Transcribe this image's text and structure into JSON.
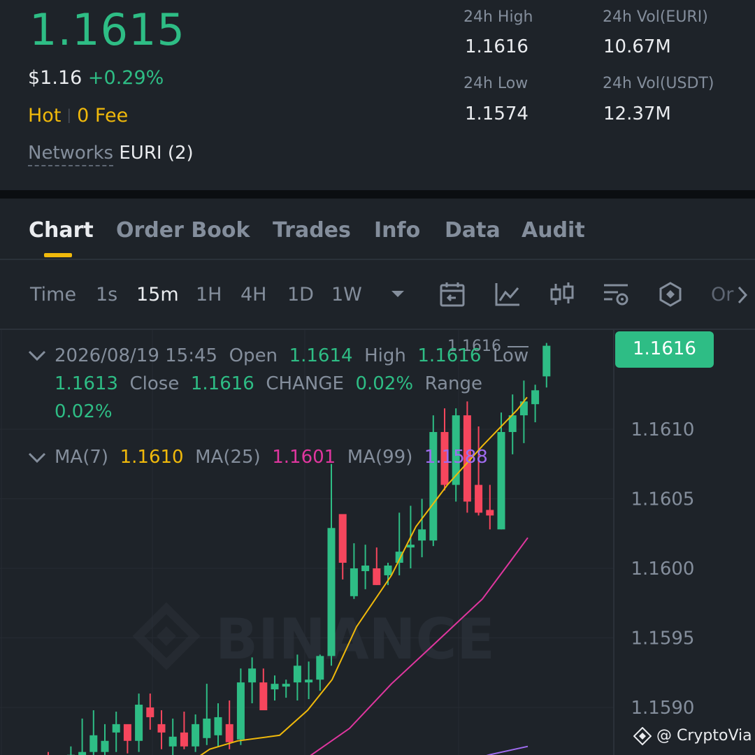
{
  "header": {
    "price": "1.1615",
    "fiat_price": "$1.16",
    "change_pct": "+0.29%",
    "hot_label": "Hot",
    "fee_label": "0 Fee",
    "networks_label": "Networks",
    "networks_value": "EURI (2)"
  },
  "stats": {
    "high_label": "24h High",
    "high_value": "1.1616",
    "low_label": "24h Low",
    "low_value": "1.1574",
    "vol_base_label": "24h Vol(EURI)",
    "vol_base_value": "10.67M",
    "vol_quote_label": "24h Vol(USDT)",
    "vol_quote_value": "12.37M"
  },
  "tabs": [
    "Chart",
    "Order Book",
    "Trades",
    "Info",
    "Data",
    "Audit"
  ],
  "timeframes": [
    "Time",
    "1s",
    "15m",
    "1H",
    "4H",
    "1D",
    "1W"
  ],
  "toolbar_more": "Or",
  "ohlc": {
    "datetime": "2026/08/19 15:45",
    "open_label": "Open",
    "open": "1.1614",
    "high_label": "High",
    "high": "1.1616",
    "low_label": "Low",
    "low": "1.1613",
    "close_label": "Close",
    "close": "1.1616",
    "change_label": "CHANGE",
    "change": "0.02%",
    "range_label": "Range",
    "range": "0.02%"
  },
  "ma": {
    "ma7_label": "MA(7)",
    "ma7": "1.1610",
    "ma25_label": "MA(25)",
    "ma25": "1.1601",
    "ma99_label": "MA(99)",
    "ma99": "1.1588"
  },
  "price_tag": "1.1616",
  "high_marker": "1.1616",
  "watermark_brand": "BINANCE",
  "credit": "@ CryptoVia",
  "colors": {
    "up": "#2ebd85",
    "down": "#f6465d",
    "ma7": "#f0b90b",
    "ma25": "#e0369f",
    "ma99": "#9f6cf0",
    "bg": "#1e2329"
  },
  "chart_data": {
    "type": "candlestick",
    "y_ticks": [
      1.161,
      1.1605,
      1.16,
      1.1595,
      1.159
    ],
    "ylim": [
      1.15857,
      1.16174
    ],
    "candles": [
      {
        "o": 1.15864,
        "h": 1.15868,
        "l": 1.15857,
        "c": 1.1586
      },
      {
        "o": 1.15861,
        "h": 1.15862,
        "l": 1.15857,
        "c": 1.15858
      },
      {
        "o": 1.1586,
        "h": 1.15872,
        "l": 1.15857,
        "c": 1.15866
      },
      {
        "o": 1.15858,
        "h": 1.15892,
        "l": 1.15857,
        "c": 1.15868
      },
      {
        "o": 1.15868,
        "h": 1.15898,
        "l": 1.15862,
        "c": 1.1588
      },
      {
        "o": 1.15868,
        "h": 1.15888,
        "l": 1.15858,
        "c": 1.15876
      },
      {
        "o": 1.15882,
        "h": 1.15897,
        "l": 1.15868,
        "c": 1.15888
      },
      {
        "o": 1.15888,
        "h": 1.15885,
        "l": 1.15867,
        "c": 1.15876
      },
      {
        "o": 1.15876,
        "h": 1.1591,
        "l": 1.15868,
        "c": 1.15902
      },
      {
        "o": 1.159,
        "h": 1.1591,
        "l": 1.15884,
        "c": 1.15893
      },
      {
        "o": 1.15888,
        "h": 1.15898,
        "l": 1.1587,
        "c": 1.15882
      },
      {
        "o": 1.15872,
        "h": 1.15892,
        "l": 1.15865,
        "c": 1.15879
      },
      {
        "o": 1.15882,
        "h": 1.15897,
        "l": 1.1587,
        "c": 1.15872
      },
      {
        "o": 1.15872,
        "h": 1.15895,
        "l": 1.15868,
        "c": 1.15888
      },
      {
        "o": 1.15878,
        "h": 1.15917,
        "l": 1.15873,
        "c": 1.15892
      },
      {
        "o": 1.1588,
        "h": 1.15903,
        "l": 1.15872,
        "c": 1.15893
      },
      {
        "o": 1.15888,
        "h": 1.15905,
        "l": 1.1587,
        "c": 1.15875
      },
      {
        "o": 1.15877,
        "h": 1.15928,
        "l": 1.15873,
        "c": 1.15918
      },
      {
        "o": 1.15918,
        "h": 1.15936,
        "l": 1.15903,
        "c": 1.15928
      },
      {
        "o": 1.15918,
        "h": 1.15928,
        "l": 1.15905,
        "c": 1.15898
      },
      {
        "o": 1.15913,
        "h": 1.15923,
        "l": 1.15905,
        "c": 1.15917
      },
      {
        "o": 1.15915,
        "h": 1.1592,
        "l": 1.15907,
        "c": 1.15917
      },
      {
        "o": 1.15918,
        "h": 1.15938,
        "l": 1.15905,
        "c": 1.1593
      },
      {
        "o": 1.15918,
        "h": 1.15933,
        "l": 1.15906,
        "c": 1.1592
      },
      {
        "o": 1.1592,
        "h": 1.15938,
        "l": 1.15912,
        "c": 1.15937
      },
      {
        "o": 1.15937,
        "h": 1.16075,
        "l": 1.1593,
        "c": 1.16029
      },
      {
        "o": 1.16039,
        "h": 1.16032,
        "l": 1.15992,
        "c": 1.16004
      },
      {
        "o": 1.1598,
        "h": 1.16018,
        "l": 1.15978,
        "c": 1.16
      },
      {
        "o": 1.15998,
        "h": 1.16017,
        "l": 1.15985,
        "c": 1.16002
      },
      {
        "o": 1.16,
        "h": 1.16015,
        "l": 1.15988,
        "c": 1.15988
      },
      {
        "o": 1.15995,
        "h": 1.16004,
        "l": 1.15988,
        "c": 1.16002
      },
      {
        "o": 1.16004,
        "h": 1.1604,
        "l": 1.15995,
        "c": 1.16012
      },
      {
        "o": 1.16015,
        "h": 1.16045,
        "l": 1.16,
        "c": 1.16017
      },
      {
        "o": 1.1602,
        "h": 1.1605,
        "l": 1.16008,
        "c": 1.16028
      },
      {
        "o": 1.1602,
        "h": 1.1611,
        "l": 1.16016,
        "c": 1.16098
      },
      {
        "o": 1.16098,
        "h": 1.16115,
        "l": 1.16056,
        "c": 1.1606
      },
      {
        "o": 1.1606,
        "h": 1.16115,
        "l": 1.16048,
        "c": 1.1611
      },
      {
        "o": 1.1611,
        "h": 1.1612,
        "l": 1.1604,
        "c": 1.16048
      },
      {
        "o": 1.1606,
        "h": 1.16102,
        "l": 1.16038,
        "c": 1.1604
      },
      {
        "o": 1.16042,
        "h": 1.1606,
        "l": 1.16028,
        "c": 1.16038
      },
      {
        "o": 1.16028,
        "h": 1.16112,
        "l": 1.16028,
        "c": 1.16098
      },
      {
        "o": 1.16098,
        "h": 1.16125,
        "l": 1.16082,
        "c": 1.1611
      },
      {
        "o": 1.1611,
        "h": 1.16135,
        "l": 1.1609,
        "c": 1.1612
      },
      {
        "o": 1.16118,
        "h": 1.16132,
        "l": 1.16105,
        "c": 1.16128
      },
      {
        "o": 1.16138,
        "h": 1.16162,
        "l": 1.1613,
        "c": 1.1616
      }
    ],
    "ma7": [
      {
        "x": 262,
        "y": 1.15857
      },
      {
        "x": 300,
        "y": 1.1587
      },
      {
        "x": 340,
        "y": 1.15876
      },
      {
        "x": 400,
        "y": 1.1588
      },
      {
        "x": 440,
        "y": 1.15898
      },
      {
        "x": 475,
        "y": 1.1592
      },
      {
        "x": 510,
        "y": 1.15958
      },
      {
        "x": 560,
        "y": 1.15995
      },
      {
        "x": 595,
        "y": 1.1603
      },
      {
        "x": 640,
        "y": 1.1606
      },
      {
        "x": 690,
        "y": 1.16088
      },
      {
        "x": 740,
        "y": 1.16114
      },
      {
        "x": 754,
        "y": 1.16123
      }
    ],
    "ma25": [
      {
        "x": 420,
        "y": 1.15857
      },
      {
        "x": 500,
        "y": 1.15885
      },
      {
        "x": 560,
        "y": 1.15917
      },
      {
        "x": 620,
        "y": 1.15945
      },
      {
        "x": 690,
        "y": 1.15978
      },
      {
        "x": 730,
        "y": 1.16005
      },
      {
        "x": 755,
        "y": 1.16022
      }
    ],
    "ma99": [
      {
        "x": 640,
        "y": 1.15857
      },
      {
        "x": 700,
        "y": 1.15866
      },
      {
        "x": 755,
        "y": 1.15872
      }
    ]
  }
}
